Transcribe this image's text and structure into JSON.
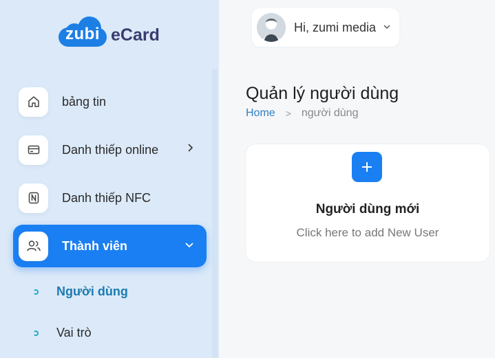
{
  "brand": {
    "logo_mark": "zubi",
    "logo_text": "eCard",
    "accent": "#1a7ff2"
  },
  "sidebar": {
    "items": [
      {
        "label": "bảng tin",
        "icon": "home-icon"
      },
      {
        "label": "Danh thiếp online",
        "icon": "card-icon",
        "has_arrow": true
      },
      {
        "label": "Danh thiếp NFC",
        "icon": "nfc-icon"
      },
      {
        "label": "Thành viên",
        "icon": "users-icon",
        "active": true,
        "expanded": true
      }
    ],
    "subitems": [
      {
        "label": "Người dùng",
        "active": true
      },
      {
        "label": "Vai trò"
      }
    ]
  },
  "header": {
    "greeting": "Hi, zumi media"
  },
  "page": {
    "title": "Quản lý người dùng",
    "breadcrumb": {
      "home": "Home",
      "separator": ">",
      "current": "người dùng"
    }
  },
  "add_user": {
    "title": "Người dùng mới",
    "subtitle": "Click here to add New User"
  }
}
